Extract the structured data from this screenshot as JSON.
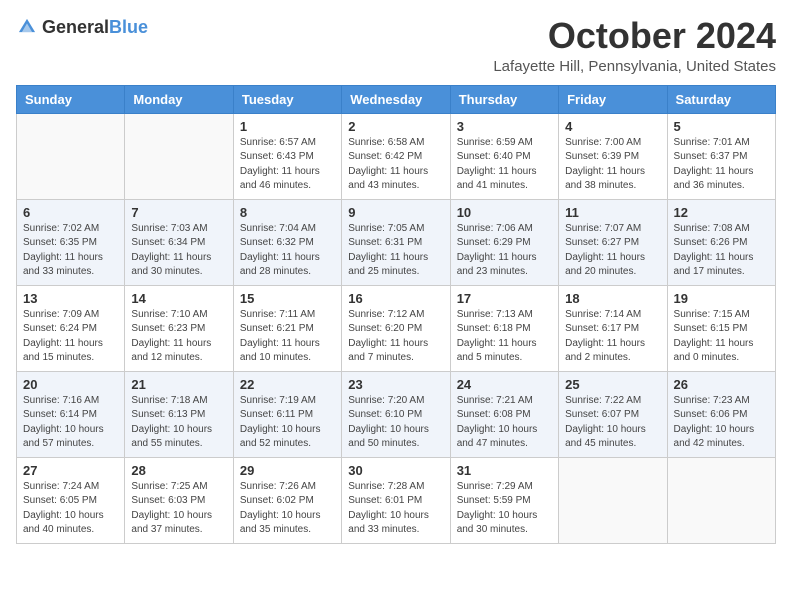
{
  "header": {
    "logo_general": "General",
    "logo_blue": "Blue",
    "month_title": "October 2024",
    "location": "Lafayette Hill, Pennsylvania, United States"
  },
  "weekdays": [
    "Sunday",
    "Monday",
    "Tuesday",
    "Wednesday",
    "Thursday",
    "Friday",
    "Saturday"
  ],
  "weeks": [
    [
      {
        "day": "",
        "info": ""
      },
      {
        "day": "",
        "info": ""
      },
      {
        "day": "1",
        "info": "Sunrise: 6:57 AM\nSunset: 6:43 PM\nDaylight: 11 hours and 46 minutes."
      },
      {
        "day": "2",
        "info": "Sunrise: 6:58 AM\nSunset: 6:42 PM\nDaylight: 11 hours and 43 minutes."
      },
      {
        "day": "3",
        "info": "Sunrise: 6:59 AM\nSunset: 6:40 PM\nDaylight: 11 hours and 41 minutes."
      },
      {
        "day": "4",
        "info": "Sunrise: 7:00 AM\nSunset: 6:39 PM\nDaylight: 11 hours and 38 minutes."
      },
      {
        "day": "5",
        "info": "Sunrise: 7:01 AM\nSunset: 6:37 PM\nDaylight: 11 hours and 36 minutes."
      }
    ],
    [
      {
        "day": "6",
        "info": "Sunrise: 7:02 AM\nSunset: 6:35 PM\nDaylight: 11 hours and 33 minutes."
      },
      {
        "day": "7",
        "info": "Sunrise: 7:03 AM\nSunset: 6:34 PM\nDaylight: 11 hours and 30 minutes."
      },
      {
        "day": "8",
        "info": "Sunrise: 7:04 AM\nSunset: 6:32 PM\nDaylight: 11 hours and 28 minutes."
      },
      {
        "day": "9",
        "info": "Sunrise: 7:05 AM\nSunset: 6:31 PM\nDaylight: 11 hours and 25 minutes."
      },
      {
        "day": "10",
        "info": "Sunrise: 7:06 AM\nSunset: 6:29 PM\nDaylight: 11 hours and 23 minutes."
      },
      {
        "day": "11",
        "info": "Sunrise: 7:07 AM\nSunset: 6:27 PM\nDaylight: 11 hours and 20 minutes."
      },
      {
        "day": "12",
        "info": "Sunrise: 7:08 AM\nSunset: 6:26 PM\nDaylight: 11 hours and 17 minutes."
      }
    ],
    [
      {
        "day": "13",
        "info": "Sunrise: 7:09 AM\nSunset: 6:24 PM\nDaylight: 11 hours and 15 minutes."
      },
      {
        "day": "14",
        "info": "Sunrise: 7:10 AM\nSunset: 6:23 PM\nDaylight: 11 hours and 12 minutes."
      },
      {
        "day": "15",
        "info": "Sunrise: 7:11 AM\nSunset: 6:21 PM\nDaylight: 11 hours and 10 minutes."
      },
      {
        "day": "16",
        "info": "Sunrise: 7:12 AM\nSunset: 6:20 PM\nDaylight: 11 hours and 7 minutes."
      },
      {
        "day": "17",
        "info": "Sunrise: 7:13 AM\nSunset: 6:18 PM\nDaylight: 11 hours and 5 minutes."
      },
      {
        "day": "18",
        "info": "Sunrise: 7:14 AM\nSunset: 6:17 PM\nDaylight: 11 hours and 2 minutes."
      },
      {
        "day": "19",
        "info": "Sunrise: 7:15 AM\nSunset: 6:15 PM\nDaylight: 11 hours and 0 minutes."
      }
    ],
    [
      {
        "day": "20",
        "info": "Sunrise: 7:16 AM\nSunset: 6:14 PM\nDaylight: 10 hours and 57 minutes."
      },
      {
        "day": "21",
        "info": "Sunrise: 7:18 AM\nSunset: 6:13 PM\nDaylight: 10 hours and 55 minutes."
      },
      {
        "day": "22",
        "info": "Sunrise: 7:19 AM\nSunset: 6:11 PM\nDaylight: 10 hours and 52 minutes."
      },
      {
        "day": "23",
        "info": "Sunrise: 7:20 AM\nSunset: 6:10 PM\nDaylight: 10 hours and 50 minutes."
      },
      {
        "day": "24",
        "info": "Sunrise: 7:21 AM\nSunset: 6:08 PM\nDaylight: 10 hours and 47 minutes."
      },
      {
        "day": "25",
        "info": "Sunrise: 7:22 AM\nSunset: 6:07 PM\nDaylight: 10 hours and 45 minutes."
      },
      {
        "day": "26",
        "info": "Sunrise: 7:23 AM\nSunset: 6:06 PM\nDaylight: 10 hours and 42 minutes."
      }
    ],
    [
      {
        "day": "27",
        "info": "Sunrise: 7:24 AM\nSunset: 6:05 PM\nDaylight: 10 hours and 40 minutes."
      },
      {
        "day": "28",
        "info": "Sunrise: 7:25 AM\nSunset: 6:03 PM\nDaylight: 10 hours and 37 minutes."
      },
      {
        "day": "29",
        "info": "Sunrise: 7:26 AM\nSunset: 6:02 PM\nDaylight: 10 hours and 35 minutes."
      },
      {
        "day": "30",
        "info": "Sunrise: 7:28 AM\nSunset: 6:01 PM\nDaylight: 10 hours and 33 minutes."
      },
      {
        "day": "31",
        "info": "Sunrise: 7:29 AM\nSunset: 5:59 PM\nDaylight: 10 hours and 30 minutes."
      },
      {
        "day": "",
        "info": ""
      },
      {
        "day": "",
        "info": ""
      }
    ]
  ]
}
